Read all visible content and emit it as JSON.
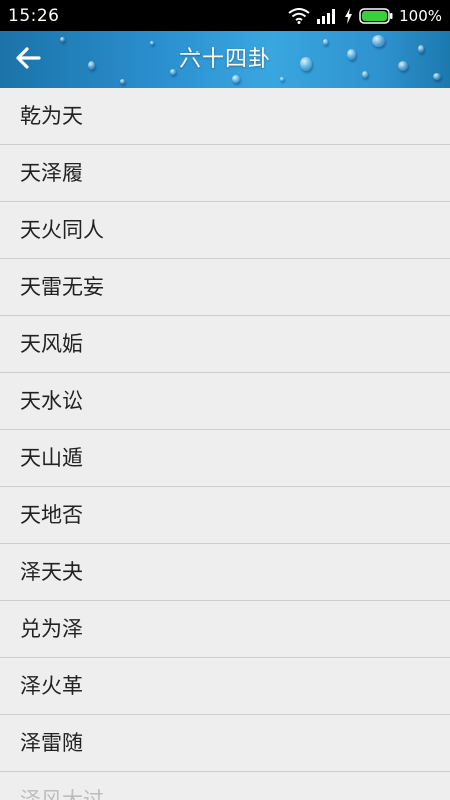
{
  "status_bar": {
    "time": "15:26",
    "battery_percent": "100%",
    "icons": [
      "wifi-icon",
      "signal-icon",
      "charging-icon",
      "battery-icon"
    ]
  },
  "header": {
    "title": "六十四卦",
    "back_icon": "back-arrow-icon",
    "accent_color": "#2a8fcf"
  },
  "gua_list": {
    "items": [
      "乾为天",
      "天泽履",
      "天火同人",
      "天雷无妄",
      "天风姤",
      "天水讼",
      "天山遁",
      "天地否",
      "泽天夬",
      "兑为泽",
      "泽火革",
      "泽雷随",
      "泽风大过"
    ]
  }
}
